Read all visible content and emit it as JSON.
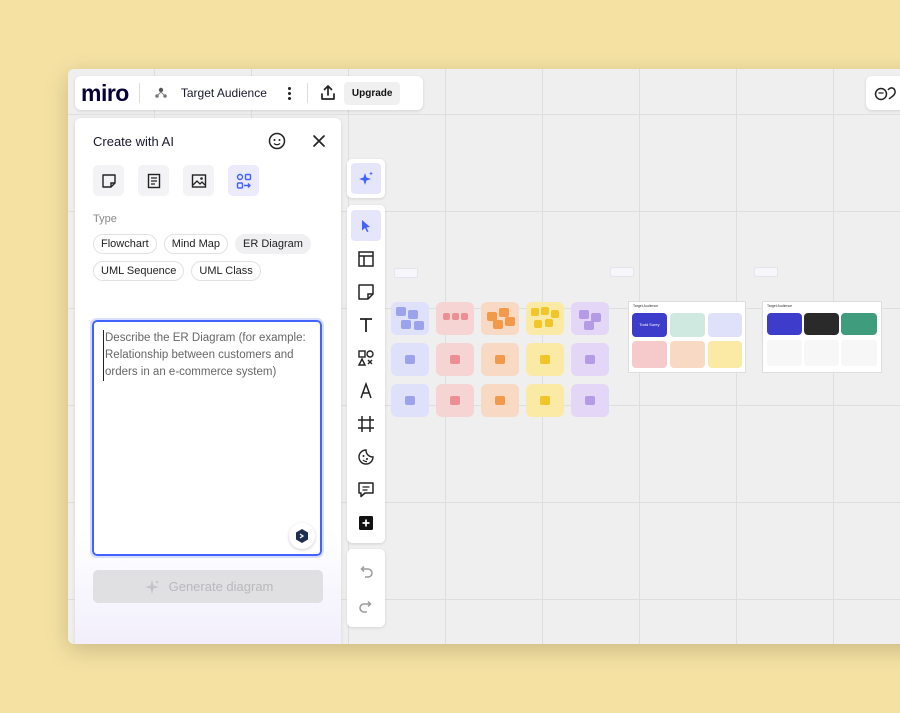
{
  "app": {
    "logo": "miro",
    "board_title": "Target Audience",
    "upgrade_label": "Upgrade"
  },
  "panel": {
    "title": "Create with AI",
    "modes": [
      "sticky-note",
      "document",
      "image",
      "diagram"
    ],
    "type_label": "Type",
    "types": [
      "Flowchart",
      "Mind Map",
      "ER Diagram",
      "UML Sequence",
      "UML Class"
    ],
    "selected_type": "ER Diagram",
    "prompt_placeholder": "Describe the ER Diagram (for example: Relationship between customers and orders in an e-commerce system)",
    "generate_label": "Generate diagram"
  },
  "toolbar": {
    "tools": [
      "ai-sparkle",
      "select",
      "templates",
      "sticky-note",
      "text",
      "shapes",
      "pen",
      "frame",
      "stickers",
      "comment",
      "add"
    ],
    "history": [
      "undo",
      "redo"
    ]
  },
  "board_cards": {
    "card1": {
      "title": "Target Audience",
      "persona_label": "Todd Surey"
    },
    "card2": {
      "title": "Target Audience"
    }
  },
  "colors": {
    "accent": "#4262ff",
    "background": "#f5e2a3",
    "lavender": "#dfe1fb",
    "pink": "#f6d4d4",
    "peach": "#f8d9c4",
    "yellow": "#fbeaa6",
    "purple": "#e3d6f7"
  }
}
